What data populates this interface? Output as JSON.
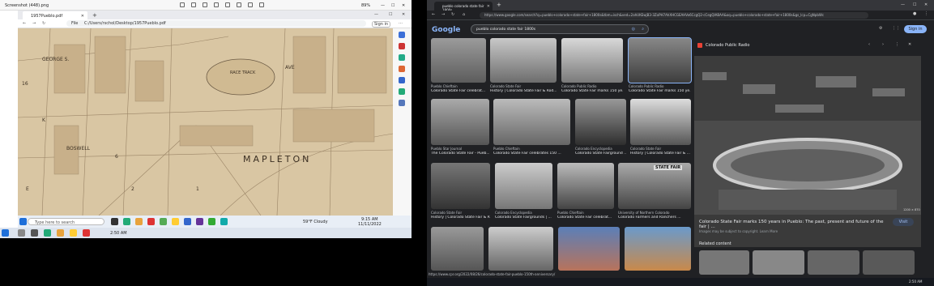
{
  "left_window": {
    "title": "Screenshot (448).png",
    "zoom": "89%",
    "browser_tab": "1957Pueblo.pdf",
    "address_prefix": "File",
    "address": "C:/Users/rschol/Desktop/1957Pueblo.pdf",
    "sign_in": "Sign in",
    "map_labels": [
      "RACE TRACK",
      "MAPLETON",
      "GEORGE S.",
      "BOSWELL",
      "AVE",
      "16",
      "6",
      "2",
      "1",
      "E",
      "K"
    ],
    "taskbar_search": "Type here to search",
    "weather": "59°F Cloudy",
    "time": "9:15 AM",
    "date": "11/11/2022",
    "bottom_time": "2:50 AM"
  },
  "right_window": {
    "tab_title": "pueblo colorado state fair 1800s",
    "address": "https://www.google.com/search?q=pueblo+colorado+state+fair+1800s&tbm=isch&ved=2ahUKEwjB3-3ZoPH7AhXHCGEAHVo6CcgQ2-cCegQIABAA&oq=pueblo+colorado+state+fair+1800s&gs_lcp=CgNpbWc",
    "google_logo": "Google",
    "search_query": "pueblo colorado state fair 1800s",
    "sign_in": "Sign in",
    "status_url": "https://www.cpr.org/2022/08/26/colorado-state-fair-pueblo-150th-anniversary/",
    "results": [
      {
        "source": "Pueblo Chieftain",
        "caption": "Colorado State Fair celebrat..."
      },
      {
        "source": "Colorado State Fair",
        "caption": "History | Colorado State Fair & Rod..."
      },
      {
        "source": "Colorado Public Radio",
        "caption": "Colorado State Fair marks 150 ye..."
      },
      {
        "source": "Colorado Public Radio",
        "caption": "Colorado State Fair marks 150 ye..."
      },
      {
        "source": "Pueblo Star Journal",
        "caption": "The Colorado State Fair - Pueb..."
      },
      {
        "source": "Pueblo Chieftain",
        "caption": "Colorado State Fair celebrates 150 ..."
      },
      {
        "source": "Colorado Encyclopedia",
        "caption": "Colorado State Fairground ..."
      },
      {
        "source": "Colorado State Fair",
        "caption": "History | Colorado State Fair & ..."
      },
      {
        "source": "Colorado State Fair",
        "caption": "History | Colorado State Fair & R..."
      },
      {
        "source": "Colorado Encyclopedia",
        "caption": "Colorado State Fairgrounds | ..."
      },
      {
        "source": "Pueblo Chieftain",
        "caption": "Colorado State Fair celebrat..."
      },
      {
        "source": "University of Northern Colorado",
        "caption": "Colorado Farmers and Ranchers ..."
      }
    ],
    "panel": {
      "source": "Colorado Public Radio",
      "title": "Colorado State Fair marks 150 years in Pueblo: The past, present and future of the fair | ...",
      "visit": "Visit",
      "copyright": "Images may be subject to copyright. Learn More",
      "related": "Related content",
      "size": "1200 × 870"
    },
    "state_fair_sign": "STATE FAIR",
    "time": "2:50 AM"
  }
}
